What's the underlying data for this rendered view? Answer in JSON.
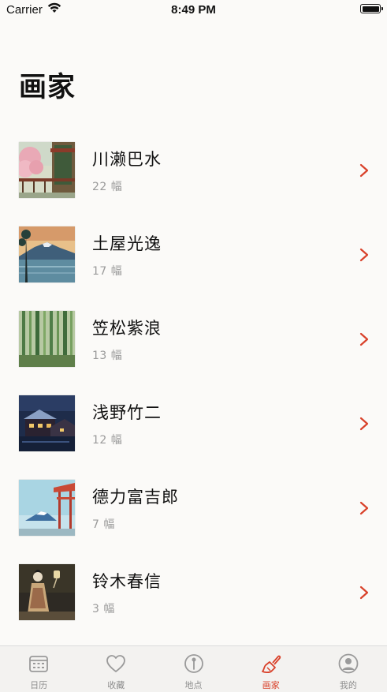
{
  "status_bar": {
    "carrier": "Carrier",
    "time": "8:49 PM"
  },
  "page": {
    "title": "画家"
  },
  "artists": [
    {
      "name": "川濑巴水",
      "count": "22 幅",
      "thumb": "cherry-blossom-shrine"
    },
    {
      "name": "土屋光逸",
      "count": "17 幅",
      "thumb": "lake-mountain-sunset"
    },
    {
      "name": "笠松紫浪",
      "count": "13 幅",
      "thumb": "bamboo-forest"
    },
    {
      "name": "浅野竹二",
      "count": "12 幅",
      "thumb": "night-village"
    },
    {
      "name": "德力富吉郎",
      "count": "7 幅",
      "thumb": "mount-fuji-pagoda"
    },
    {
      "name": "铃木春信",
      "count": "3 幅",
      "thumb": "woman-lantern"
    }
  ],
  "tabs": [
    {
      "label": "日历",
      "icon": "calendar-icon",
      "active": false
    },
    {
      "label": "收藏",
      "icon": "heart-icon",
      "active": false
    },
    {
      "label": "地点",
      "icon": "pin-icon",
      "active": false
    },
    {
      "label": "画家",
      "icon": "paintbrush-icon",
      "active": true
    },
    {
      "label": "我的",
      "icon": "person-icon",
      "active": false
    }
  ],
  "colors": {
    "accent": "#d9412a",
    "secondary_text": "#9a9a9a",
    "background": "#fbfaf8"
  }
}
